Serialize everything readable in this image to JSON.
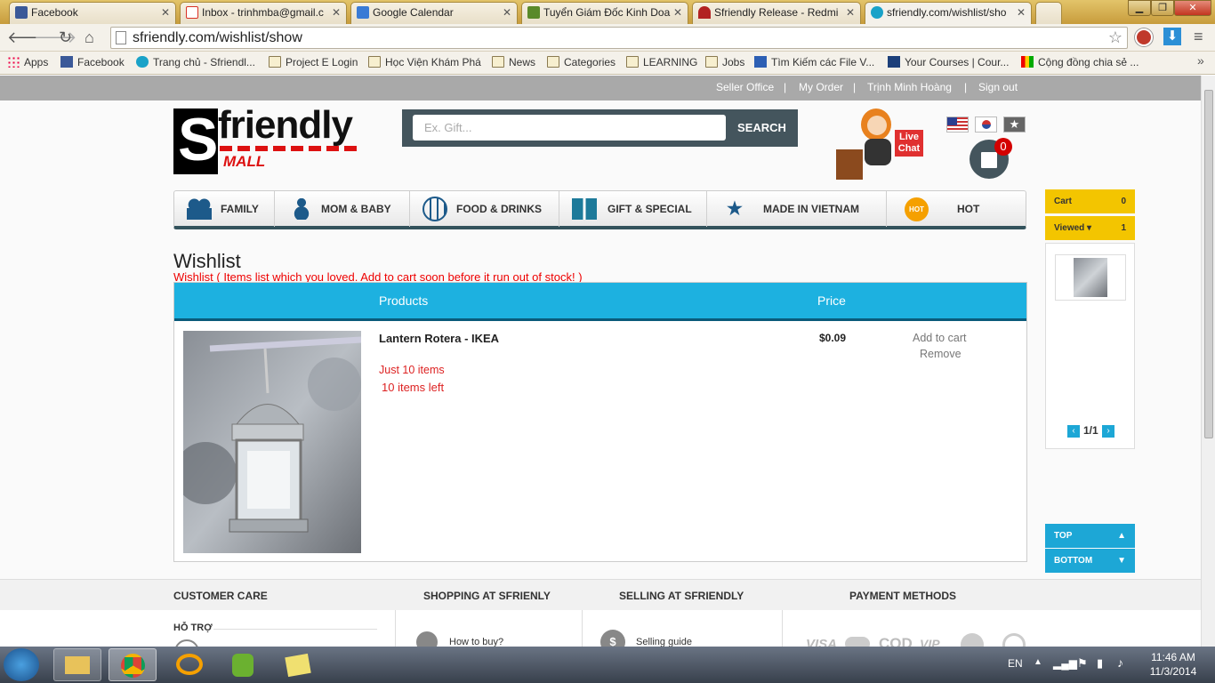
{
  "browser": {
    "tabs": [
      {
        "title": "Facebook",
        "color": "#3b5998"
      },
      {
        "title": "Inbox - trinhmba@gmail.c",
        "color": "#d93025"
      },
      {
        "title": "Google Calendar",
        "color": "#3a7bd5"
      },
      {
        "title": "Tuyển Giám Đốc Kinh Doa",
        "color": "#5a8a2a"
      },
      {
        "title": "Sfriendly Release - Redmi",
        "color": "#b22222"
      },
      {
        "title": "sfriendly.com/wishlist/sho",
        "color": "#1aa2c8"
      }
    ],
    "url": "sfriendly.com/wishlist/show",
    "bookmarks": [
      "Apps",
      "Facebook",
      "Trang chủ - Sfriendl...",
      "Project E Login",
      "Học Viện Khám Phá",
      "News",
      "Categories",
      "LEARNING",
      "Jobs",
      "Tìm Kiếm các File V...",
      "Your Courses | Cour...",
      "Cộng đồng chia sẻ ..."
    ]
  },
  "topbar": {
    "seller": "Seller Office",
    "order": "My Order",
    "user": "Trịnh Minh Hoàng",
    "signout": "Sign out"
  },
  "logo": {
    "line1": "friendly",
    "letter": "S",
    "mall": "MALL"
  },
  "search": {
    "placeholder": "Ex. Gift...",
    "button": "SEARCH"
  },
  "live_chat": "Live Chat",
  "cart_count": "0",
  "menu": [
    "FAMILY",
    "MOM & BABY",
    "FOOD & DRINKS",
    "GIFT & SPECIAL",
    "MADE IN VIETNAM",
    "HOT"
  ],
  "menu_hot_badge": "HOT",
  "wishlist": {
    "title": "Wishlist",
    "subtitle": "Wishlist ( Items list which you loved. Add to cart soon before it run out of stock! )",
    "col_products": "Products",
    "col_price": "Price",
    "item": {
      "name": "Lantern Rotera - IKEA",
      "stock": "Just 10 items",
      "left": "10 items left",
      "price": "$0.09",
      "add": "Add to cart",
      "remove": "Remove"
    }
  },
  "side": {
    "cart": "Cart",
    "cart_count": "0",
    "viewed": "Viewed",
    "viewed_count": "1",
    "page": "1/1",
    "top": "TOP",
    "bottom": "BOTTOM"
  },
  "footer": {
    "headings": [
      "CUSTOMER CARE",
      "SHOPPING AT SFRIENLY",
      "SELLING AT SFRIENDLY",
      "PAYMENT METHODS"
    ],
    "support": "HỖ TRỢ",
    "howto": "How to buy?",
    "selling": "Selling guide",
    "payments": [
      "VISA",
      "COD",
      "VIP"
    ]
  },
  "taskbar": {
    "lang": "EN",
    "time": "11:46 AM",
    "date": "11/3/2014"
  }
}
